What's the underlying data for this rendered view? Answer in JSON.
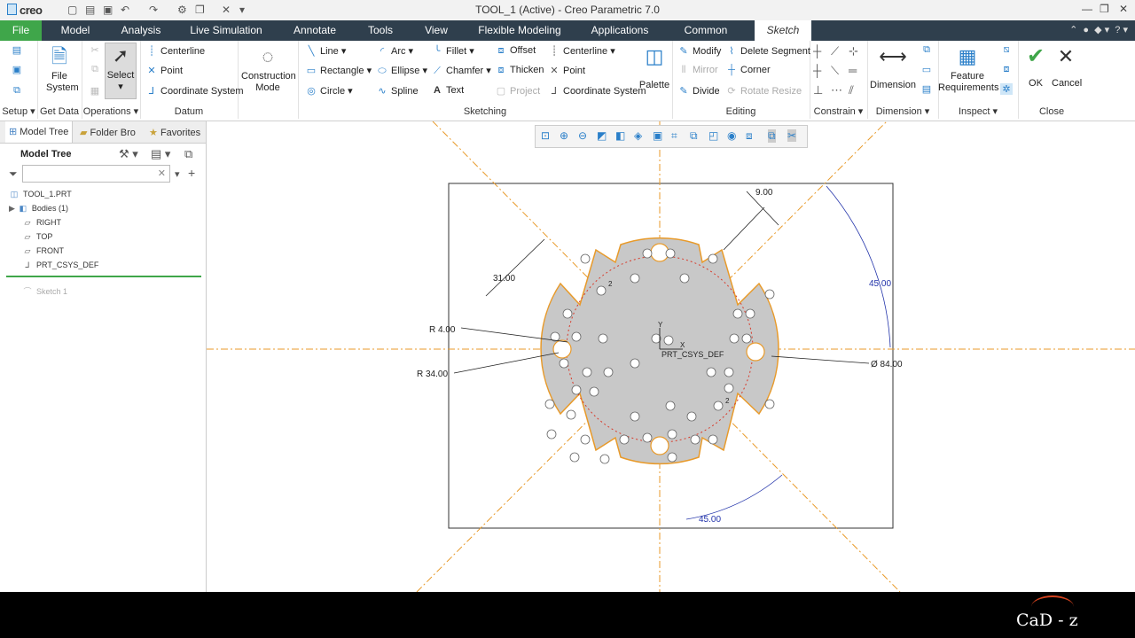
{
  "app": {
    "logo": "creo",
    "window_title": "TOOL_1 (Active) - Creo Parametric 7.0"
  },
  "menus": [
    "File",
    "Model",
    "Analysis",
    "Live Simulation",
    "Annotate",
    "Tools",
    "View",
    "Flexible Modeling",
    "Applications",
    "Common",
    "Sketch"
  ],
  "ribbon": {
    "setup": {
      "label": "Setup"
    },
    "get_data": {
      "file_system": "File System",
      "label": "Get Data"
    },
    "operations": {
      "select": "Select",
      "label": "Operations"
    },
    "datum": {
      "centerline": "Centerline",
      "point": "Point",
      "coord": "Coordinate System",
      "label": "Datum"
    },
    "construction": {
      "mode": "Construction Mode"
    },
    "sketching": {
      "line": "Line",
      "rectangle": "Rectangle",
      "circle": "Circle",
      "arc": "Arc",
      "ellipse": "Ellipse",
      "spline": "Spline",
      "fillet": "Fillet",
      "chamfer": "Chamfer",
      "text": "Text",
      "offset": "Offset",
      "thicken": "Thicken",
      "project": "Project",
      "centerline": "Centerline",
      "point": "Point",
      "coord": "Coordinate System",
      "palette": "Palette",
      "label": "Sketching"
    },
    "editing": {
      "modify": "Modify",
      "delete_segment": "Delete Segment",
      "mirror": "Mirror",
      "corner": "Corner",
      "divide": "Divide",
      "rotate_resize": "Rotate Resize",
      "label": "Editing"
    },
    "constrain": {
      "label": "Constrain"
    },
    "dimension": {
      "btn": "Dimension",
      "label": "Dimension"
    },
    "inspect": {
      "feature_req": "Feature Requirements",
      "label": "Inspect"
    },
    "close": {
      "ok": "OK",
      "cancel": "Cancel",
      "label": "Close"
    }
  },
  "panel": {
    "tabs": [
      "Model Tree",
      "Folder Bro",
      "Favorites"
    ],
    "tree_title": "Model Tree",
    "nodes": [
      "TOOL_1.PRT",
      "Bodies (1)",
      "RIGHT",
      "TOP",
      "FRONT",
      "PRT_CSYS_DEF",
      "Sketch 1"
    ]
  },
  "sketch": {
    "dims": {
      "d1": "9.00",
      "d2": "31.00",
      "d3": "45.00",
      "d4": "R 4.00",
      "d5": "R 34.00",
      "d6": "Ø 84.00",
      "d7": "45.00",
      "c1": "2",
      "c2": "2"
    },
    "csys_label": "PRT_CSYS_DEF",
    "axis_y": "Y",
    "axis_x": "X"
  },
  "watermark": "CaD - z",
  "colors": {
    "file_tab": "#3fa64a",
    "menubar": "#2f3f4d",
    "accent": "#2a7fc9",
    "sketch_edge": "#e89a2a",
    "dimension_blue": "#2233aa"
  }
}
